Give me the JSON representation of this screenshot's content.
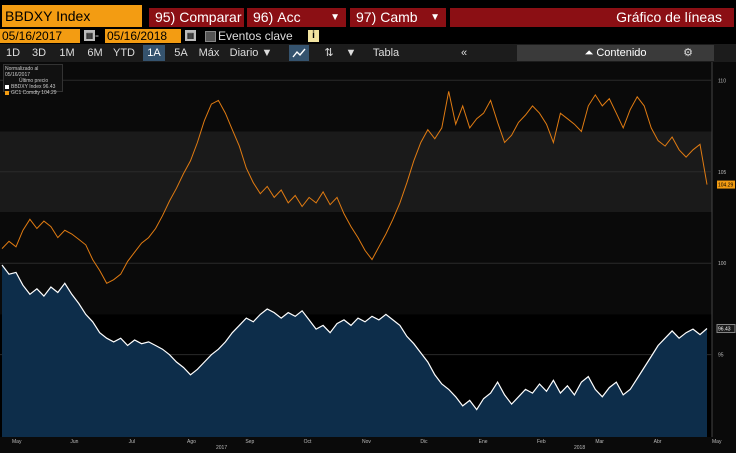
{
  "header": {
    "ticker": "BBDXY Index",
    "compare": {
      "code": "95)",
      "label": "Comparar"
    },
    "actions": {
      "code": "96)",
      "label": "Acc"
    },
    "change": {
      "code": "97)",
      "label": "Camb"
    },
    "title": "Gráfico de líneas"
  },
  "range": {
    "start": "05/16/2017",
    "end": "05/16/2018",
    "separator": "-",
    "events_label": "Eventos clave",
    "info": "i"
  },
  "toolbar": {
    "periods": [
      "1D",
      "3D",
      "1M",
      "6M",
      "YTD",
      "1A",
      "5A",
      "Máx"
    ],
    "active_period": "1A",
    "frequency": "Diario",
    "table_label": "Tabla",
    "content_label": "Contenido",
    "collapse": "«",
    "settings_icon": "gear-icon",
    "line_type_icon": "line-chart-icon",
    "compare_icon": "compare-icon",
    "dropdown_icon": "chevron-down-icon"
  },
  "legend": {
    "header": "Normalizado al 05/16/2017",
    "sub": "Último precio",
    "items": [
      {
        "name": "BBDXY Index",
        "value": "96.43",
        "color": "#ffffff"
      },
      {
        "name": "GC1 Comdty",
        "value": "104.29",
        "color": "#f39c12"
      }
    ]
  },
  "chart_data": {
    "type": "line",
    "x_range": [
      "2017-05-16",
      "2018-05-16"
    ],
    "months": [
      "May",
      "Jun",
      "Jul",
      "Ago",
      "Sep",
      "Oct",
      "Nov",
      "Dic",
      "Ene",
      "Feb",
      "Mar",
      "Abr",
      "May"
    ],
    "years": [
      "2017",
      "2018"
    ],
    "ylabel_ticks": [
      "110",
      "105",
      "100",
      "95"
    ],
    "y_range": [
      90.5,
      111
    ],
    "series": [
      {
        "name": "GC1 Comdty",
        "color": "#e07b12",
        "last_value": "104.29",
        "values": [
          100.8,
          101.2,
          100.9,
          101.8,
          102.4,
          101.9,
          102.3,
          102.0,
          101.4,
          101.8,
          101.6,
          101.3,
          101.0,
          100.2,
          99.6,
          98.9,
          99.1,
          99.4,
          100.1,
          100.6,
          101.1,
          101.4,
          101.9,
          102.6,
          103.4,
          104.1,
          104.9,
          105.6,
          106.6,
          107.8,
          108.7,
          108.9,
          108.2,
          107.3,
          106.4,
          105.2,
          104.4,
          103.8,
          104.2,
          103.6,
          104.0,
          103.3,
          103.7,
          103.1,
          103.6,
          103.3,
          103.9,
          103.2,
          103.6,
          102.7,
          102.0,
          101.4,
          100.7,
          100.2,
          100.9,
          101.6,
          102.4,
          103.3,
          104.4,
          105.6,
          106.6,
          107.3,
          106.8,
          107.4,
          109.4,
          107.6,
          108.6,
          107.4,
          107.9,
          108.2,
          108.9,
          107.7,
          106.6,
          107.0,
          107.7,
          108.1,
          108.6,
          108.2,
          107.6,
          106.6,
          108.2,
          107.9,
          107.6,
          107.2,
          108.6,
          109.2,
          108.6,
          109.0,
          108.2,
          107.4,
          108.4,
          109.1,
          108.6,
          107.4,
          106.7,
          106.4,
          106.9,
          106.2,
          105.8,
          106.2,
          106.5,
          104.3
        ]
      },
      {
        "name": "BBDXY Index",
        "color": "#ffffff",
        "last_value": "96.43",
        "values": [
          99.9,
          99.4,
          99.5,
          98.8,
          98.3,
          98.6,
          98.2,
          98.7,
          98.4,
          98.9,
          98.3,
          97.8,
          97.2,
          96.8,
          96.2,
          95.9,
          95.7,
          95.9,
          95.5,
          95.8,
          95.6,
          95.7,
          95.5,
          95.3,
          95.0,
          94.6,
          94.3,
          93.9,
          94.2,
          94.6,
          95.0,
          95.3,
          95.7,
          96.2,
          96.6,
          97.0,
          96.8,
          97.2,
          97.5,
          97.3,
          97.0,
          97.3,
          97.1,
          97.4,
          96.9,
          96.4,
          96.6,
          96.2,
          96.7,
          96.9,
          96.6,
          97.0,
          96.8,
          97.1,
          96.9,
          97.2,
          96.9,
          96.6,
          96.0,
          95.6,
          95.1,
          94.6,
          93.9,
          93.4,
          93.1,
          92.7,
          92.2,
          92.5,
          92.0,
          92.6,
          92.9,
          93.5,
          92.8,
          92.3,
          92.7,
          93.1,
          92.9,
          93.4,
          93.0,
          93.6,
          92.9,
          93.3,
          92.8,
          93.5,
          93.8,
          93.1,
          92.7,
          93.2,
          93.5,
          92.8,
          93.1,
          93.7,
          94.3,
          94.9,
          95.5,
          95.9,
          96.3,
          95.9,
          96.2,
          96.4,
          96.1,
          96.43
        ]
      }
    ]
  }
}
